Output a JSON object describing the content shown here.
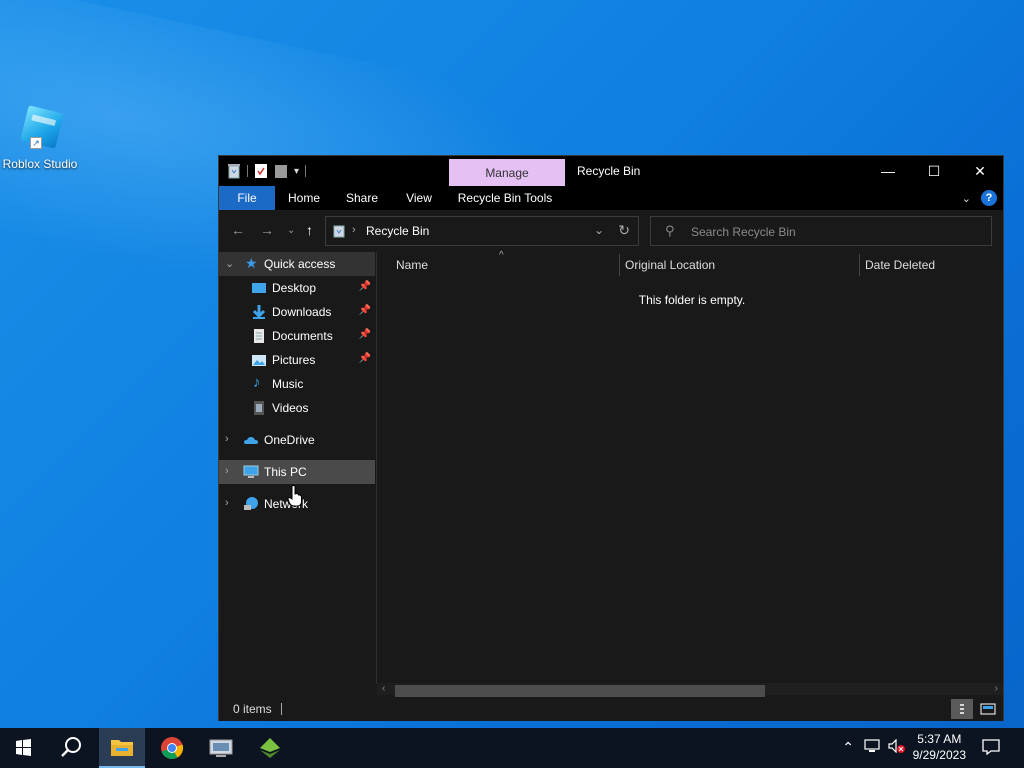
{
  "desktop": {
    "icons": [
      {
        "label": "Roblox Studio"
      }
    ]
  },
  "window": {
    "manage_tab": "Manage",
    "title": "Recycle Bin",
    "controls": {
      "minimize": "—",
      "maximize": "☐",
      "close": "✕"
    },
    "ribbon_tabs": [
      "File",
      "Home",
      "Share",
      "View",
      "Recycle Bin Tools"
    ],
    "help": "?",
    "address": {
      "path": "Recycle Bin"
    },
    "search": {
      "placeholder": "Search Recycle Bin"
    },
    "nav": {
      "quick_access": "Quick access",
      "items": [
        {
          "label": "Desktop",
          "pinned": true,
          "icon": "desktop-icon"
        },
        {
          "label": "Downloads",
          "pinned": true,
          "icon": "downloads-icon"
        },
        {
          "label": "Documents",
          "pinned": true,
          "icon": "documents-icon"
        },
        {
          "label": "Pictures",
          "pinned": true,
          "icon": "pictures-icon"
        },
        {
          "label": "Music",
          "pinned": false,
          "icon": "music-icon"
        },
        {
          "label": "Videos",
          "pinned": false,
          "icon": "videos-icon"
        }
      ],
      "onedrive": "OneDrive",
      "this_pc": "This PC",
      "network": "Network"
    },
    "columns": [
      "Name",
      "Original Location",
      "Date Deleted"
    ],
    "empty_message": "This folder is empty.",
    "status": {
      "count": "0 items"
    }
  },
  "taskbar": {
    "items": [
      "start-icon",
      "search-icon",
      "file-explorer-icon",
      "chrome-icon",
      "app-icon",
      "app-icon-green"
    ],
    "clock": {
      "time": "5:37 AM",
      "date": "9/29/2023"
    }
  },
  "colors": {
    "accent": "#1a6ac6",
    "manage_tab": "#e4c0f3",
    "window_bg": "#191919",
    "taskbar": "#0d1421"
  }
}
